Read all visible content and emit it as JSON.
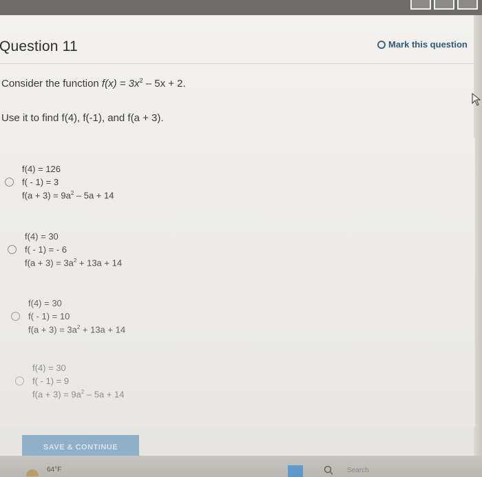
{
  "question": {
    "title": "Question 11",
    "mark_label": "Mark this question",
    "prompt_line1_prefix": "Consider the function ",
    "prompt_line1_fn": "f(x) = 3x",
    "prompt_line1_exp": "2",
    "prompt_line1_suffix": " – 5x + 2.",
    "prompt_line2": "Use it to find f(4), f(-1), and f(a + 3)."
  },
  "choices": [
    {
      "l1": "f(4) = 126",
      "l2": "f( - 1) = 3",
      "l3_a": "f(a + 3) = 9a",
      "l3_exp": "2",
      "l3_b": " – 5a + 14"
    },
    {
      "l1": "f(4) = 30",
      "l2": "f( - 1) = - 6",
      "l3_a": "f(a + 3) = 3a",
      "l3_exp": "2",
      "l3_b": " + 13a + 14"
    },
    {
      "l1": "f(4) = 30",
      "l2": "f( - 1) = 10",
      "l3_a": "f(a + 3) = 3a",
      "l3_exp": "2",
      "l3_b": " + 13a + 14"
    },
    {
      "l1": "f(4) = 30",
      "l2": "f( - 1) = 9",
      "l3_a": "f(a + 3) = 9a",
      "l3_exp": "2",
      "l3_b": " – 5a + 14"
    }
  ],
  "footer": {
    "save_label": "SAVE & CONTINUE"
  },
  "taskbar": {
    "temperature": "64°F",
    "search_placeholder": "Search"
  }
}
